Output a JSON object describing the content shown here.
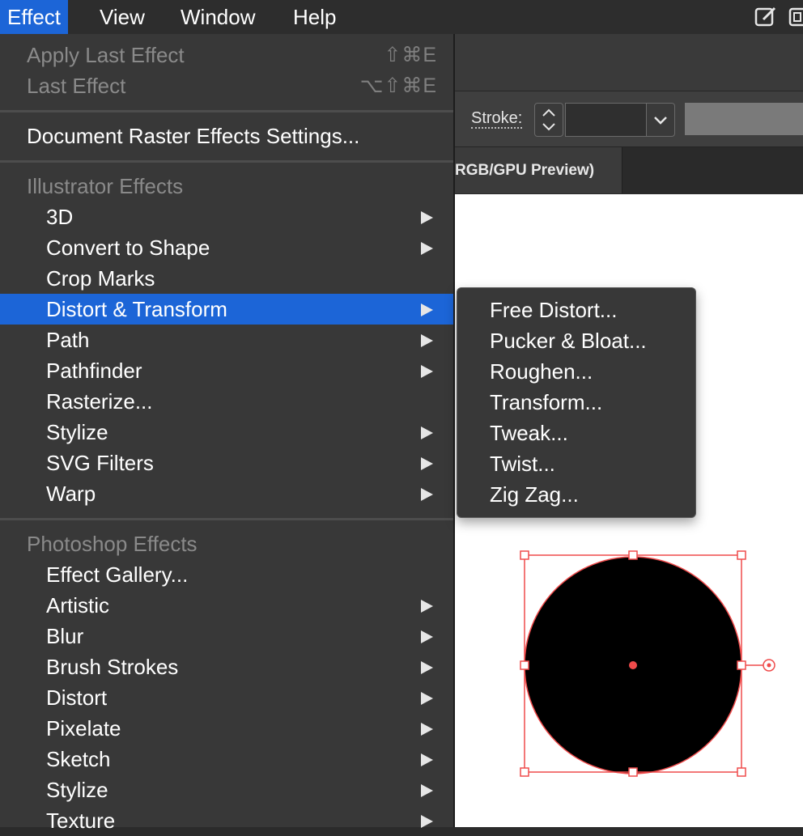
{
  "menubar": {
    "items": [
      "Effect",
      "View",
      "Window",
      "Help"
    ],
    "active": "Effect"
  },
  "toolbar": {
    "stroke_label": "Stroke:"
  },
  "document_tab": {
    "label": "RGB/GPU Preview)"
  },
  "effect_menu": {
    "apply_last_effect": {
      "label": "Apply Last Effect",
      "shortcut": "⇧⌘E"
    },
    "last_effect": {
      "label": "Last Effect",
      "shortcut": "⌥⇧⌘E"
    },
    "document_raster": "Document Raster Effects Settings...",
    "illustrator_header": "Illustrator Effects",
    "illustrator_items": [
      "3D",
      "Convert to Shape",
      "Crop Marks",
      "Distort & Transform",
      "Path",
      "Pathfinder",
      "Rasterize...",
      "Stylize",
      "SVG Filters",
      "Warp"
    ],
    "photoshop_header": "Photoshop Effects",
    "photoshop_items": [
      "Effect Gallery...",
      "Artistic",
      "Blur",
      "Brush Strokes",
      "Distort",
      "Pixelate",
      "Sketch",
      "Stylize",
      "Texture"
    ],
    "highlighted": "Distort & Transform"
  },
  "submenu": {
    "items": [
      "Free Distort...",
      "Pucker & Bloat...",
      "Roughen...",
      "Transform...",
      "Tweak...",
      "Twist...",
      "Zig Zag..."
    ]
  },
  "colors": {
    "highlight": "#1c65d7",
    "menu_bg": "#383838",
    "selection": "#ef4b4b"
  },
  "icons": [
    "compose-icon",
    "panel-icon",
    "submenu-arrow-icon",
    "stepper-icon",
    "chevron-down-icon",
    "rotate-handle-icon"
  ]
}
